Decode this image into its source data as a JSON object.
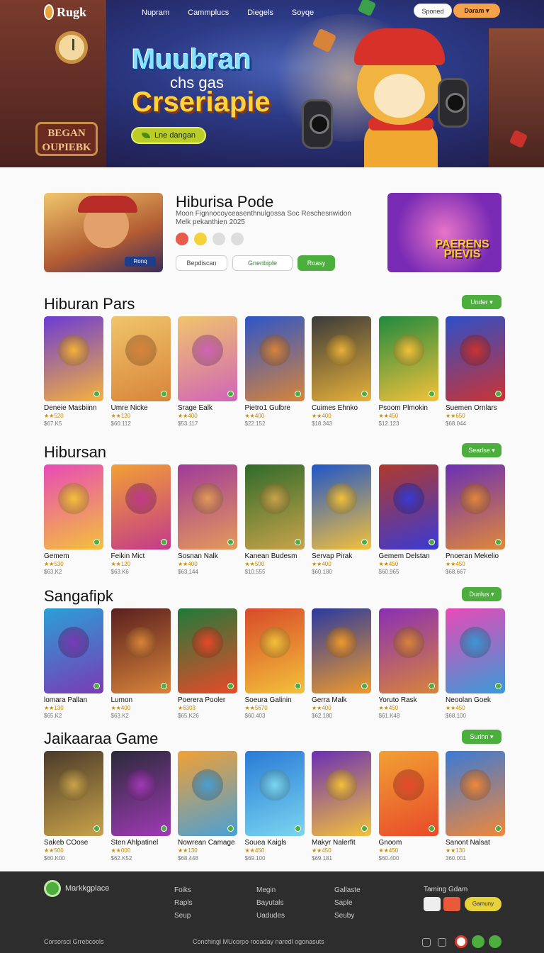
{
  "header": {
    "logo_text": "Rugk",
    "nav": [
      "Nupram",
      "Cammplucs",
      "Diegels",
      "Soyqe"
    ],
    "btn_signin": "Sponed",
    "btn_menu": "Daram ▾"
  },
  "hero": {
    "title_line1": "Muubran",
    "title_line2": "chs gas",
    "title_line3": "Crseriapie",
    "cta_label": "Lne dangan",
    "sign_text": "BEGAN OUPIEBK"
  },
  "featured": {
    "title": "Hiburisa Pode",
    "description": "Moon Fignnocoyceasenthnulgossa Soc Reschesnwidon Melk pekanthien 2025",
    "tag": "Ronq",
    "btn_primary_outline": "Bepdiscan",
    "btn_secondary_outline": "Gnenbiple",
    "btn_green": "Roasy",
    "side_label": "PAERENS PIEVIS"
  },
  "sections": [
    {
      "title": "Hiburan Pars",
      "button": "Under ▾",
      "cards": [
        {
          "name": "Deneie Masbiinn",
          "rating": "★★520",
          "price": "$67.K5",
          "color1": "#6b3bd6",
          "color2": "#f6b23a"
        },
        {
          "name": "Umre Nicke",
          "rating": "★★120",
          "price": "$60.112",
          "color1": "#f0c56b",
          "color2": "#d8843a"
        },
        {
          "name": "Srage Ealk",
          "rating": "★★400",
          "price": "$53.117",
          "color1": "#f0c56b",
          "color2": "#d164b8"
        },
        {
          "name": "Pietro1 Gulbre",
          "rating": "★★400",
          "price": "$22.152",
          "color1": "#2c56c9",
          "color2": "#d8843a"
        },
        {
          "name": "Cuimes Ehnko",
          "rating": "★★400",
          "price": "$18.343",
          "color1": "#3a3a3a",
          "color2": "#e8b13a"
        },
        {
          "name": "Psoom Plmokin",
          "rating": "★★450",
          "price": "$12.123",
          "color1": "#1f8a3e",
          "color2": "#f4c13a"
        },
        {
          "name": "Suemen Ornlars",
          "rating": "★★650",
          "price": "$68.044",
          "color1": "#2c4fc9",
          "color2": "#c33"
        }
      ]
    },
    {
      "title": "Hibursan",
      "button": "Searlse ▾",
      "cards": [
        {
          "name": "Gemem",
          "rating": "★★530",
          "price": "$63.K2",
          "color1": "#e84ab8",
          "color2": "#f4c13a"
        },
        {
          "name": "Feikin Mict",
          "rating": "★★120",
          "price": "$63.K6",
          "color1": "#f2a034",
          "color2": "#c33a8a"
        },
        {
          "name": "Sosnan Nalk",
          "rating": "★★400",
          "price": "$63.144",
          "color1": "#a03a9a",
          "color2": "#e49a5a"
        },
        {
          "name": "Kanean Budesm",
          "rating": "★★500",
          "price": "$10.555",
          "color1": "#2f6b2a",
          "color2": "#c9a34a"
        },
        {
          "name": "Servap Pirak",
          "rating": "★★400",
          "price": "$60.180",
          "color1": "#1f56c9",
          "color2": "#f4c13a"
        },
        {
          "name": "Gemem Delstan",
          "rating": "★★450",
          "price": "$60.965",
          "color1": "#b03a2a",
          "color2": "#3a3ad6"
        },
        {
          "name": "Pnoeran Mekelio",
          "rating": "★★450",
          "price": "$68.667",
          "color1": "#6a2fb5",
          "color2": "#e0883a"
        }
      ]
    },
    {
      "title": "Sangafipk",
      "button": "Durilus ▾",
      "cards": [
        {
          "name": "lomara Pallan",
          "rating": "★★130",
          "price": "$65.K2",
          "color1": "#2aa0d6",
          "color2": "#7a3ab5"
        },
        {
          "name": "Lumon",
          "rating": "★★400",
          "price": "$63.K2",
          "color1": "#5a1f1f",
          "color2": "#d8843a"
        },
        {
          "name": "Poerera Pooler",
          "rating": "★6303",
          "price": "$65.K26",
          "color1": "#1f7a3a",
          "color2": "#e84a2a"
        },
        {
          "name": "Soeura Galinin",
          "rating": "★★5670",
          "price": "$60.403",
          "color1": "#d84a2a",
          "color2": "#f4c13a"
        },
        {
          "name": "Gerra Malk",
          "rating": "★★400",
          "price": "$62.180",
          "color1": "#2a3aa0",
          "color2": "#f09a2a"
        },
        {
          "name": "Yoruto Rask",
          "rating": "★★450",
          "price": "$61.K48",
          "color1": "#8a2fb5",
          "color2": "#d8843a"
        },
        {
          "name": "Neoolan Goek",
          "rating": "★★450",
          "price": "$68.100",
          "color1": "#e84ab8",
          "color2": "#3a9ad6"
        }
      ]
    },
    {
      "title": "Jaikaaraa Game",
      "button": "Surlhn ▾",
      "cards": [
        {
          "name": "Sakeb COose",
          "rating": "★★500",
          "price": "$60.K00",
          "color1": "#4a3a2a",
          "color2": "#c9a34a"
        },
        {
          "name": "Sten Ahlpatinel",
          "rating": "★★000",
          "price": "$62.K52",
          "color1": "#2a2a3a",
          "color2": "#a03ab5"
        },
        {
          "name": "Nowrean Camage",
          "rating": "★★130",
          "price": "$68.448",
          "color1": "#f2a034",
          "color2": "#4aa0d6"
        },
        {
          "name": "Souea Kaigls",
          "rating": "★★450",
          "price": "$69.100",
          "color1": "#2a7ad6",
          "color2": "#7ad6f0"
        },
        {
          "name": "Makyr Nalerfit",
          "rating": "★★450",
          "price": "$69.181",
          "color1": "#6a2fb5",
          "color2": "#f4c13a"
        },
        {
          "name": "Gnoom",
          "rating": "★★450",
          "price": "$60.400",
          "color1": "#f2a034",
          "color2": "#e84a2a"
        },
        {
          "name": "Sanont Nalsat",
          "rating": "★★130",
          "price": "360.001",
          "color1": "#3a7ad6",
          "color2": "#f0883a"
        }
      ]
    }
  ],
  "footer": {
    "logo_text": "Markkgplace",
    "col1": [
      "Foiks",
      "Rapls",
      "Seup"
    ],
    "col2": [
      "Megin",
      "Bayutals",
      "Uadudes"
    ],
    "col3": [
      "Gallaste",
      "Saple",
      "Seuby"
    ],
    "social_title": "Taming Gdam",
    "social_btn": "Gamuny",
    "copyright": "Corsorsci Grrebcools",
    "legal": "Conchingl MUcorpo  rooaday naredl ogonasuts"
  }
}
